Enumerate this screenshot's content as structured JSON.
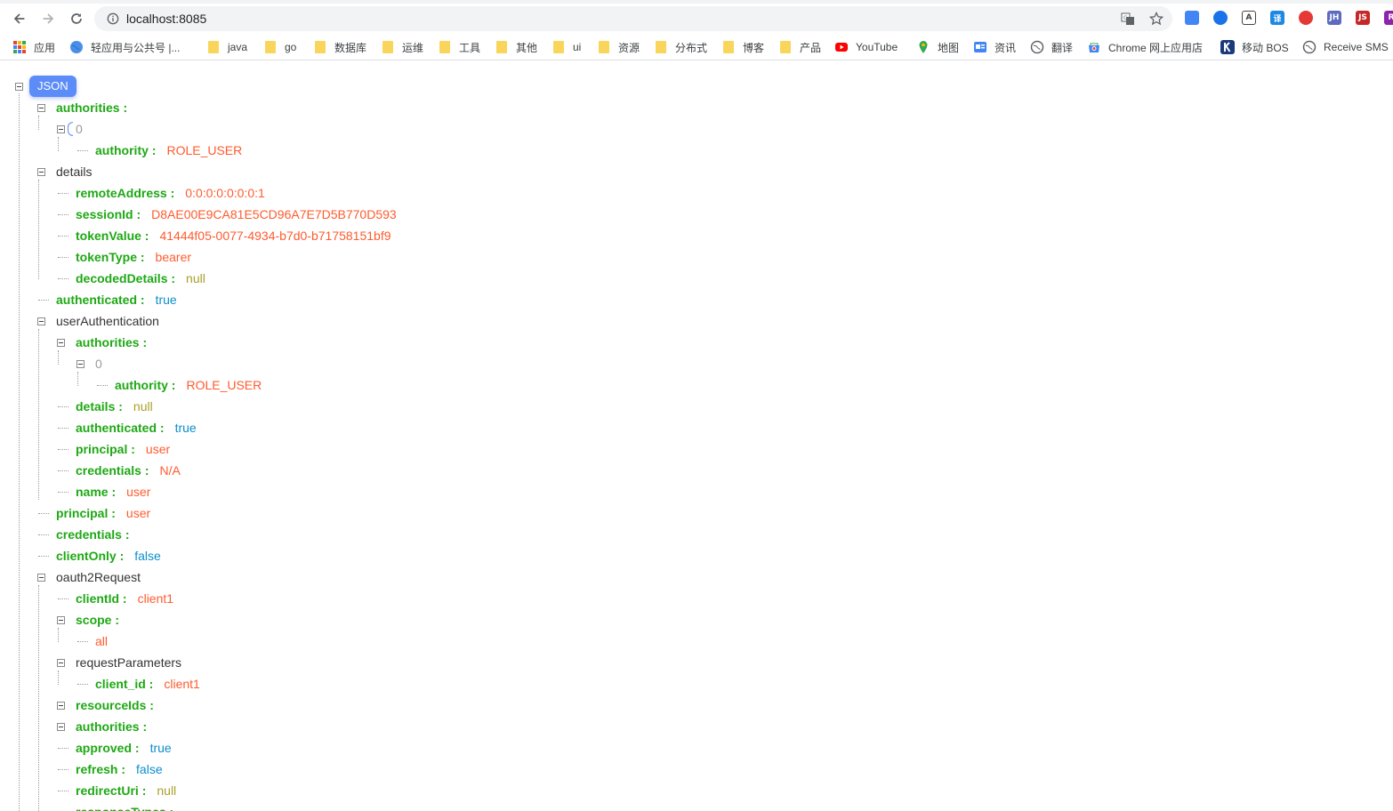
{
  "browser": {
    "url": "localhost:8085",
    "extensions": [
      {
        "name": "translate-ext-icon",
        "label": "",
        "color": "#4285f4"
      },
      {
        "name": "blue-circle-ext-icon",
        "label": "",
        "color": "#1a73e8"
      },
      {
        "name": "a-ext-icon",
        "label": "A",
        "color": "#444444"
      },
      {
        "name": "translate-cn-ext-icon",
        "label": "译",
        "color": "#1e88e5"
      },
      {
        "name": "red-circle-ext-icon",
        "label": "",
        "color": "#e53935"
      },
      {
        "name": "jh-ext-icon",
        "label": "JH",
        "color": "#5c6bc0"
      },
      {
        "name": "js-ext-icon",
        "label": "JS",
        "color": "#c62828"
      },
      {
        "name": "purple-ext-icon",
        "label": "R",
        "color": "#8e24aa"
      }
    ]
  },
  "bookmarks": [
    {
      "label": "应用",
      "icon": "apps-grid-icon"
    },
    {
      "label": "轻应用与公共号 |...",
      "icon": "globe-icon"
    },
    {
      "label": "java",
      "icon": "folder-icon"
    },
    {
      "label": "go",
      "icon": "folder-icon"
    },
    {
      "label": "数据库",
      "icon": "folder-icon"
    },
    {
      "label": "运维",
      "icon": "folder-icon"
    },
    {
      "label": "工具",
      "icon": "folder-icon"
    },
    {
      "label": "其他",
      "icon": "folder-icon"
    },
    {
      "label": "ui",
      "icon": "folder-icon"
    },
    {
      "label": "资源",
      "icon": "folder-icon"
    },
    {
      "label": "分布式",
      "icon": "folder-icon"
    },
    {
      "label": "博客",
      "icon": "folder-icon"
    },
    {
      "label": "产品",
      "icon": "folder-icon"
    },
    {
      "label": "YouTube",
      "icon": "youtube-icon"
    },
    {
      "label": "地图",
      "icon": "maps-pin-icon"
    },
    {
      "label": "资讯",
      "icon": "news-icon"
    },
    {
      "label": "翻译",
      "icon": "globe-gray-icon"
    },
    {
      "label": "Chrome 网上应用店",
      "icon": "webstore-icon"
    },
    {
      "label": "移动 BOS",
      "icon": "k-icon"
    },
    {
      "label": "Receive SMS",
      "icon": "globe-gray-icon"
    }
  ],
  "json_root_label": "JSON",
  "tree": [
    {
      "key": "authorities",
      "colon": " :",
      "value": null,
      "type": "key-bold"
    },
    {
      "key": "0",
      "colon": "",
      "value": null,
      "type": "index"
    },
    {
      "key": "authority",
      "colon": " :",
      "value": "ROLE_USER",
      "type": "str"
    },
    {
      "key": "details",
      "colon": "",
      "value": null,
      "type": "key-plain"
    },
    {
      "key": "remoteAddress",
      "colon": " :",
      "value": "0:0:0:0:0:0:0:1",
      "type": "str"
    },
    {
      "key": "sessionId",
      "colon": " :",
      "value": "D8AE00E9CA81E5CD96A7E7D5B770D593",
      "type": "str"
    },
    {
      "key": "tokenValue",
      "colon": " :",
      "value": "41444f05-0077-4934-b7d0-b71758151bf9",
      "type": "str"
    },
    {
      "key": "tokenType",
      "colon": " :",
      "value": "bearer",
      "type": "str"
    },
    {
      "key": "decodedDetails",
      "colon": " :",
      "value": "null",
      "type": "null"
    },
    {
      "key": "authenticated",
      "colon": " :",
      "value": "true",
      "type": "bool"
    },
    {
      "key": "userAuthentication",
      "colon": "",
      "value": null,
      "type": "key-plain"
    },
    {
      "key": "authorities",
      "colon": " :",
      "value": null,
      "type": "key-bold"
    },
    {
      "key": "0",
      "colon": "",
      "value": null,
      "type": "index"
    },
    {
      "key": "authority",
      "colon": " :",
      "value": "ROLE_USER",
      "type": "str"
    },
    {
      "key": "details",
      "colon": " :",
      "value": "null",
      "type": "null"
    },
    {
      "key": "authenticated",
      "colon": " :",
      "value": "true",
      "type": "bool"
    },
    {
      "key": "principal",
      "colon": " :",
      "value": "user",
      "type": "str"
    },
    {
      "key": "credentials",
      "colon": " :",
      "value": "N/A",
      "type": "str"
    },
    {
      "key": "name",
      "colon": " :",
      "value": "user",
      "type": "str"
    },
    {
      "key": "principal",
      "colon": " :",
      "value": "user",
      "type": "str"
    },
    {
      "key": "credentials",
      "colon": " :",
      "value": null,
      "type": "key-bold"
    },
    {
      "key": "clientOnly",
      "colon": " :",
      "value": "false",
      "type": "bool"
    },
    {
      "key": "oauth2Request",
      "colon": "",
      "value": null,
      "type": "key-plain"
    },
    {
      "key": "clientId",
      "colon": " :",
      "value": "client1",
      "type": "str"
    },
    {
      "key": "scope",
      "colon": " :",
      "value": null,
      "type": "key-bold"
    },
    {
      "key": "",
      "colon": "",
      "value": "all",
      "type": "bare-str"
    },
    {
      "key": "requestParameters",
      "colon": "",
      "value": null,
      "type": "key-plain"
    },
    {
      "key": "client_id",
      "colon": " :",
      "value": "client1",
      "type": "str"
    },
    {
      "key": "resourceIds",
      "colon": " :",
      "value": null,
      "type": "key-bold"
    },
    {
      "key": "authorities",
      "colon": " :",
      "value": null,
      "type": "key-bold"
    },
    {
      "key": "approved",
      "colon": " :",
      "value": "true",
      "type": "bool"
    },
    {
      "key": "refresh",
      "colon": " :",
      "value": "false",
      "type": "bool"
    },
    {
      "key": "redirectUri",
      "colon": " :",
      "value": "null",
      "type": "null"
    },
    {
      "key": "responseTypes",
      "colon": " :",
      "value": null,
      "type": "key-bold"
    }
  ]
}
